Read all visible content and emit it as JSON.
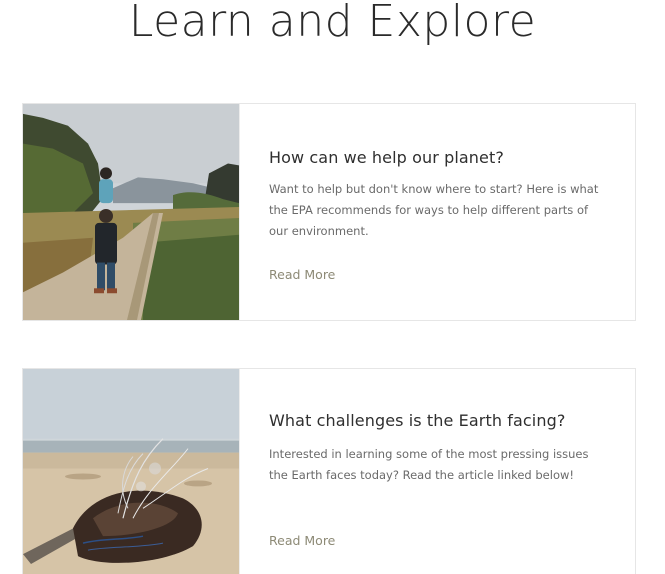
{
  "page": {
    "title": "Learn and Explore"
  },
  "articles": [
    {
      "title": "How can we help our planet?",
      "excerpt": "Want to help but don't know where to start? Here is what the EPA recommends for ways to help different parts of our environment.",
      "link_label": "Read More",
      "image": "father-carrying-child-on-boardwalk-photo"
    },
    {
      "title": "What challenges is the Earth facing?",
      "excerpt": "Interested in learning some of the most pressing issues the Earth faces today? Read the article linked below!",
      "link_label": "Read More",
      "image": "plastic-debris-on-beach-photo"
    }
  ],
  "colors": {
    "link": "#8d8a76",
    "border": "#e6e6e6",
    "text": "#6a6a6a"
  }
}
